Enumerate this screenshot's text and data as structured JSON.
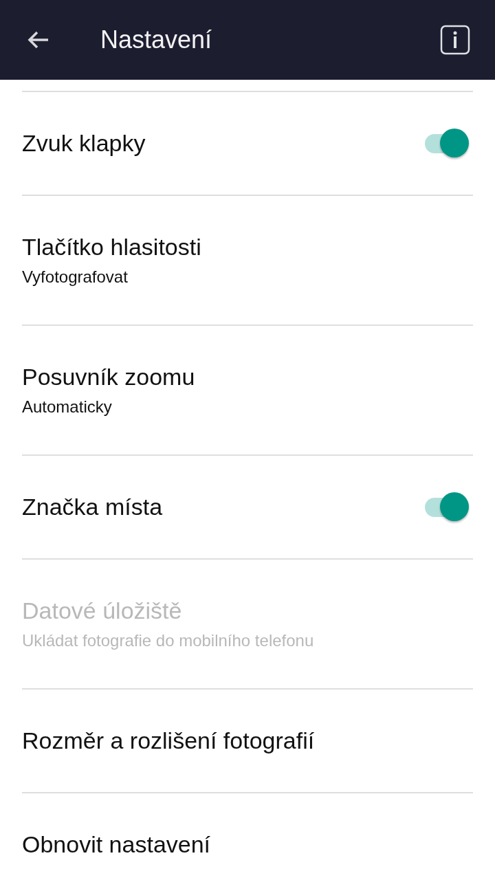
{
  "header": {
    "title": "Nastavení"
  },
  "settings": [
    {
      "kind": "toggle",
      "title": "Zvuk klapky",
      "on": true,
      "disabled": false
    },
    {
      "kind": "option",
      "title": "Tlačítko hlasitosti",
      "value": "Vyfotografovat",
      "disabled": false
    },
    {
      "kind": "option",
      "title": "Posuvník zoomu",
      "value": "Automaticky",
      "disabled": false
    },
    {
      "kind": "toggle",
      "title": "Značka místa",
      "on": true,
      "disabled": false
    },
    {
      "kind": "option",
      "title": "Datové úložiště",
      "value": "Ukládat fotografie do mobilního telefonu",
      "disabled": true
    },
    {
      "kind": "action",
      "title": "Rozměr a rozlišení fotografií",
      "disabled": false
    },
    {
      "kind": "action",
      "title": "Obnovit nastavení",
      "disabled": false
    }
  ]
}
